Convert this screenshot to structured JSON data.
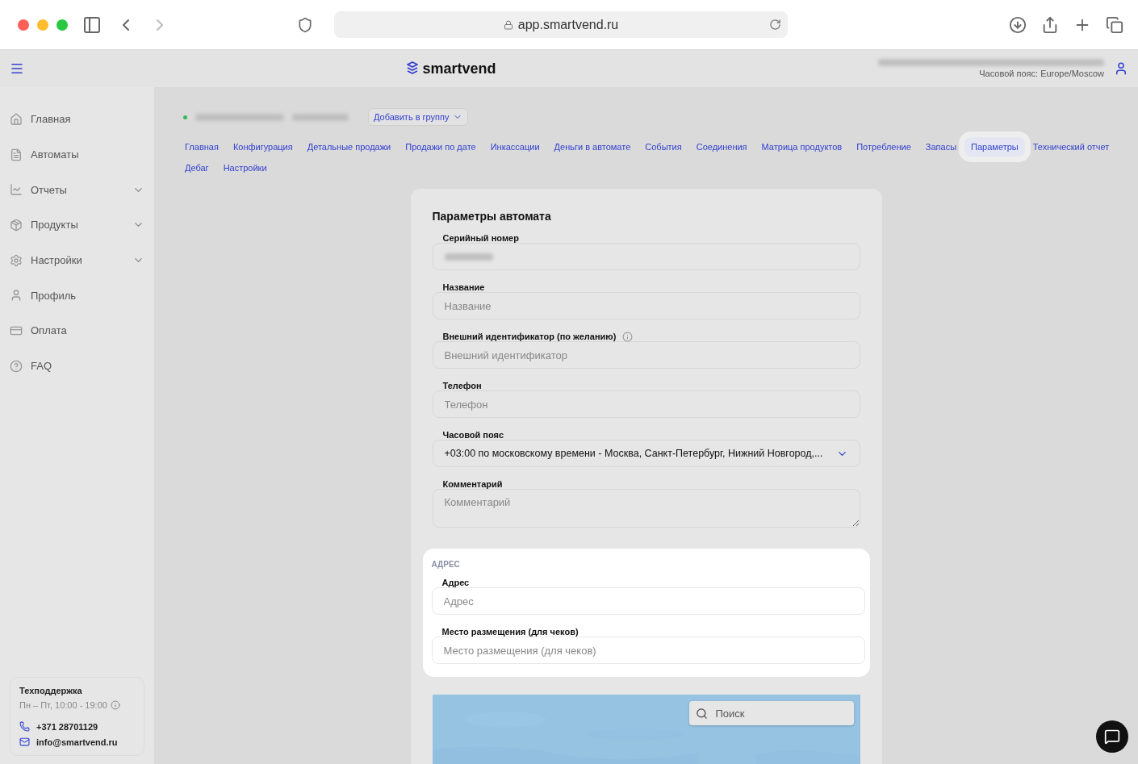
{
  "browser": {
    "url": "app.smartvend.ru"
  },
  "header": {
    "logo": "smartvend",
    "timezone": "Часовой пояс: Europe/Moscow"
  },
  "sidebar": {
    "items": [
      {
        "label": "Главная",
        "kind": "link"
      },
      {
        "label": "Автоматы",
        "kind": "link"
      },
      {
        "label": "Отчеты",
        "kind": "group"
      },
      {
        "label": "Продукты",
        "kind": "group"
      },
      {
        "label": "Настройки",
        "kind": "group"
      },
      {
        "label": "Профиль",
        "kind": "link"
      },
      {
        "label": "Оплата",
        "kind": "link"
      },
      {
        "label": "FAQ",
        "kind": "link"
      }
    ],
    "support": {
      "title": "Техподдержка",
      "hours": "Пн – Пт, 10:00 - 19:00",
      "phone": "+371 28701129",
      "email": "info@smartvend.ru"
    }
  },
  "machine": {
    "online": true,
    "group_button": "Добавить в группу"
  },
  "tabs": [
    {
      "label": "Главная",
      "selected": false
    },
    {
      "label": "Конфигурация",
      "selected": false
    },
    {
      "label": "Детальные продажи",
      "selected": false
    },
    {
      "label": "Продажи по дате",
      "selected": false
    },
    {
      "label": "Инкассации",
      "selected": false
    },
    {
      "label": "Деньги в автомате",
      "selected": false
    },
    {
      "label": "События",
      "selected": false
    },
    {
      "label": "Соединения",
      "selected": false
    },
    {
      "label": "Матрица продуктов",
      "selected": false
    },
    {
      "label": "Потребление",
      "selected": false
    },
    {
      "label": "Запасы",
      "selected": false
    },
    {
      "label": "Параметры",
      "selected": true
    },
    {
      "label": "Технический отчет",
      "selected": false
    },
    {
      "label": "Дебаг",
      "selected": false
    },
    {
      "label": "Настройки",
      "selected": false
    }
  ],
  "form": {
    "title": "Параметры автомата",
    "fields": [
      {
        "kind": "hidden",
        "label": "Серийный номер"
      },
      {
        "kind": "input",
        "label": "Название",
        "placeholder": "Название"
      },
      {
        "kind": "input",
        "label": "Внешний идентификатор (по желанию)",
        "placeholder": "Внешний идентификатор",
        "info": true
      },
      {
        "kind": "input",
        "label": "Телефон",
        "placeholder": "Телефон"
      },
      {
        "kind": "select",
        "label": "Часовой пояс",
        "value": "+03:00 по московскому времени - Москва, Санкт-Петербург, Нижний Новгород,..."
      },
      {
        "kind": "textarea",
        "label": "Комментарий",
        "placeholder": "Комментарий"
      }
    ]
  },
  "address": {
    "title": "АДРЕС",
    "fields": [
      {
        "kind": "input",
        "label": "Адрес",
        "placeholder": "Адрес"
      },
      {
        "kind": "input",
        "label": "Место размещения (для чеков)",
        "placeholder": "Место размещения (для чеков)"
      }
    ]
  },
  "map": {
    "search_placeholder": "Поиск"
  }
}
